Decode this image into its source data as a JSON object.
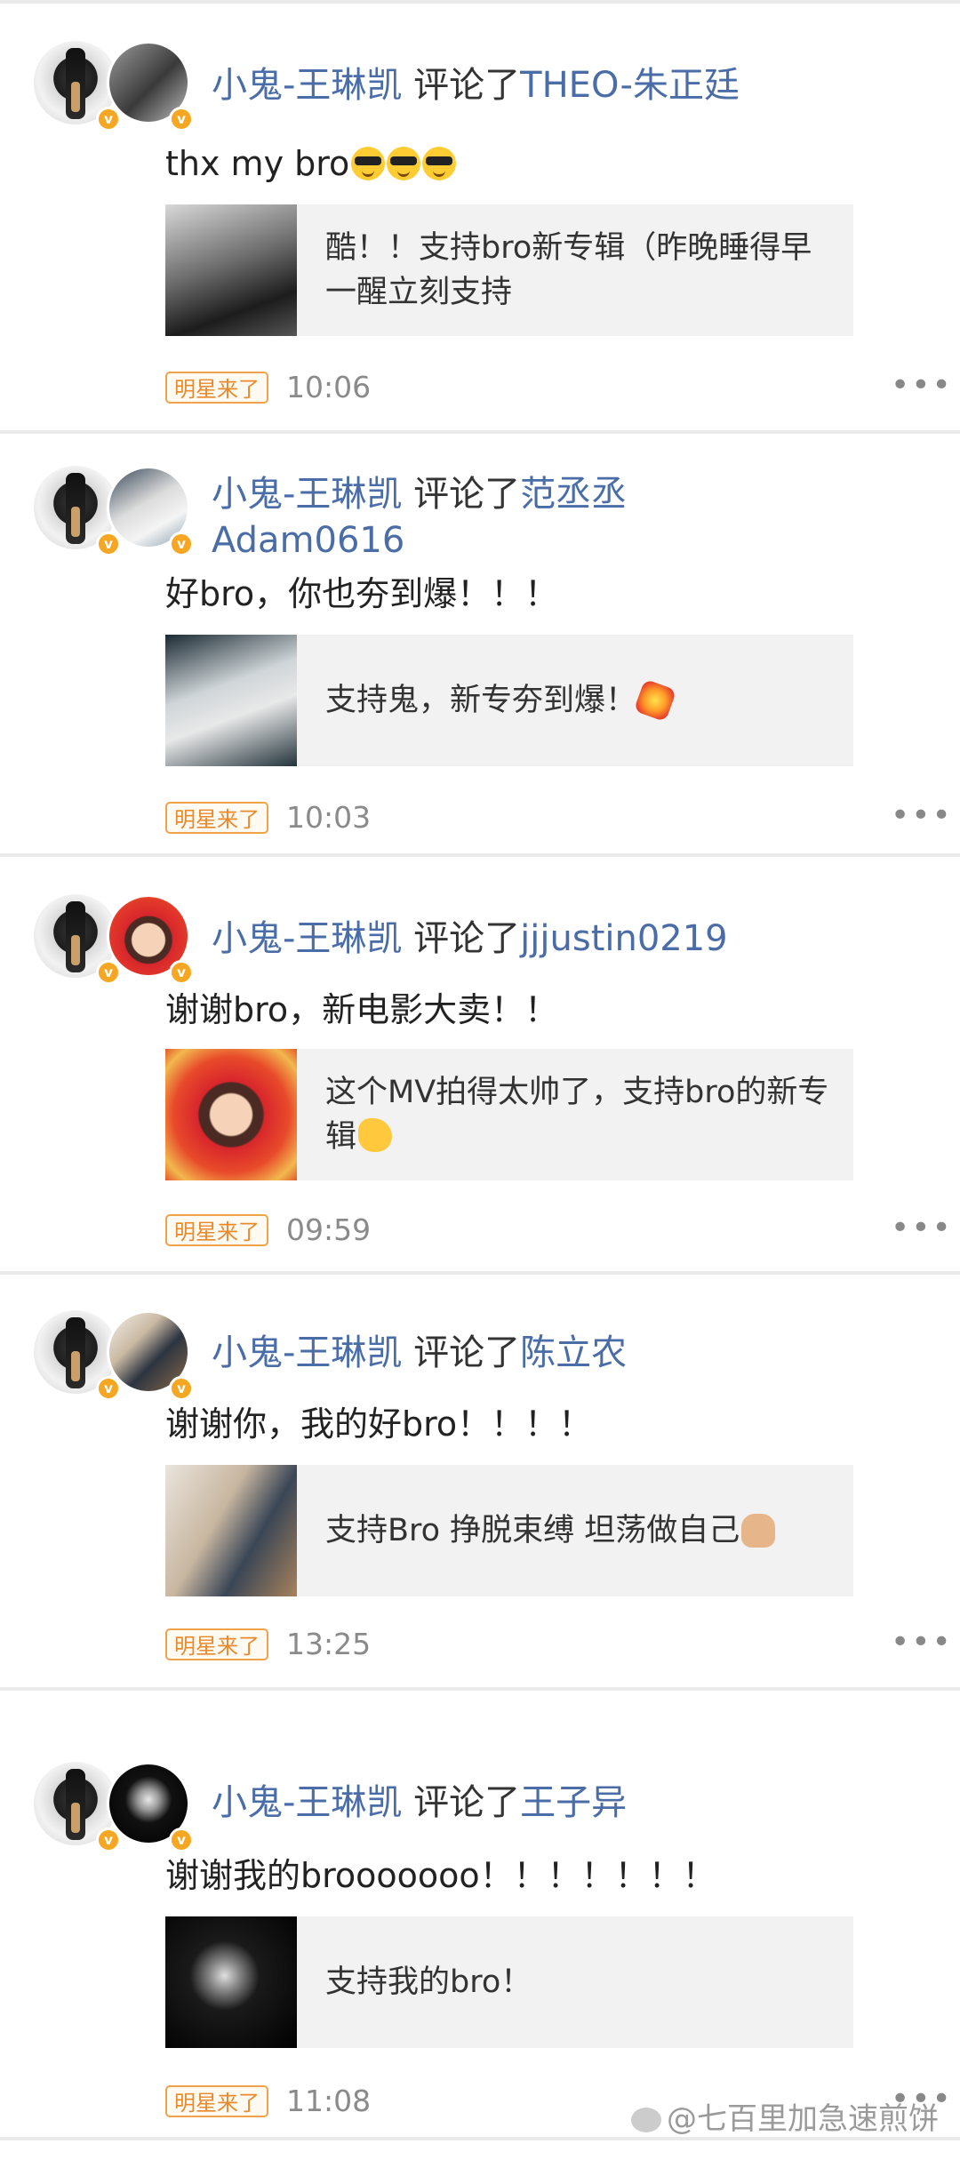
{
  "items": [
    {
      "name": "小鬼-王琳凯",
      "verb": "评论了",
      "target": "THEO-朱正廷",
      "target_line2": "",
      "comment": "thx my bro",
      "comment_emoji": [
        "cool-icon",
        "cool-icon",
        "cool-icon"
      ],
      "quote": "酷！！支持bro新专辑（昨晚睡得早 一醒立刻支持",
      "quote_emoji": "",
      "badge": "明星来了",
      "time": "10:06"
    },
    {
      "name": "小鬼-王琳凯",
      "verb": "评论了",
      "target": "范丞丞",
      "target_line2": "Adam0616",
      "comment": "好bro，你也夯到爆！！！",
      "comment_emoji": [],
      "quote": "支持鬼，新专夯到爆！",
      "quote_emoji": "boom-icon",
      "badge": "明星来了",
      "time": "10:03"
    },
    {
      "name": "小鬼-王琳凯",
      "verb": "评论了",
      "target": "jjjustin0219",
      "target_line2": "",
      "comment": "谢谢bro，新电影大卖！！",
      "comment_emoji": [],
      "quote": "这个MV拍得太帅了，支持bro的新专辑",
      "quote_emoji": "muscle-icon",
      "badge": "明星来了",
      "time": "09:59"
    },
    {
      "name": "小鬼-王琳凯",
      "verb": "评论了",
      "target": "陈立农",
      "target_line2": "",
      "comment": "谢谢你，我的好bro！！！！",
      "comment_emoji": [],
      "quote": "支持Bro 挣脱束缚 坦荡做自己",
      "quote_emoji": "thumbs-up-icon",
      "badge": "明星来了",
      "time": "13:25"
    },
    {
      "name": "小鬼-王琳凯",
      "verb": "评论了",
      "target": "王子异",
      "target_line2": "",
      "comment": "谢谢我的brooooooo！！！！！！！",
      "comment_emoji": [],
      "quote": "支持我的bro！",
      "quote_emoji": "",
      "badge": "明星来了",
      "time": "11:08"
    }
  ],
  "more_label": "•••",
  "verified_mark": "v",
  "watermark": "@七百里加急速煎饼"
}
